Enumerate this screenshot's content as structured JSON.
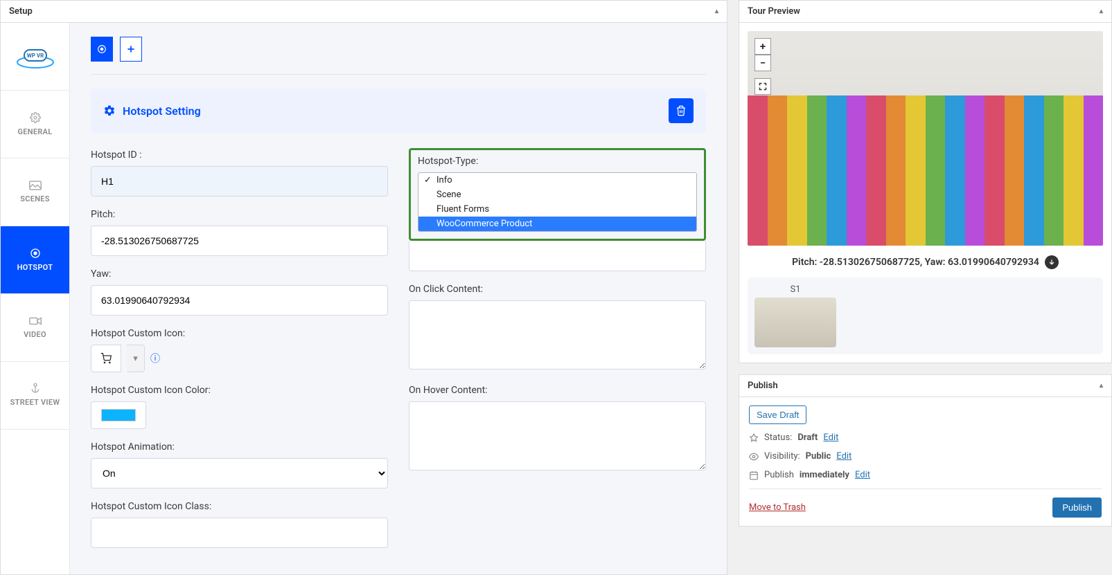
{
  "panels": {
    "setup_title": "Setup",
    "preview_title": "Tour Preview",
    "publish_title": "Publish"
  },
  "sidebar": {
    "items": [
      {
        "label": "GENERAL"
      },
      {
        "label": "SCENES"
      },
      {
        "label": "HOTSPOT"
      },
      {
        "label": "VIDEO"
      },
      {
        "label": "STREET VIEW"
      }
    ]
  },
  "section": {
    "title": "Hotspot Setting"
  },
  "left_fields": {
    "hotspot_id_label": "Hotspot ID :",
    "hotspot_id_value": "H1",
    "pitch_label": "Pitch:",
    "pitch_value": "-28.513026750687725",
    "yaw_label": "Yaw:",
    "yaw_value": "63.01990640792934",
    "custom_icon_label": "Hotspot Custom Icon:",
    "icon_color_label": "Hotspot Custom Icon Color:",
    "animation_label": "Hotspot Animation:",
    "animation_value": "On",
    "icon_class_label": "Hotspot Custom Icon Class:"
  },
  "right_fields": {
    "type_label": "Hotspot-Type:",
    "type_options": [
      "Info",
      "Scene",
      "Fluent Forms",
      "WooCommerce Product"
    ],
    "type_checked": "Info",
    "type_selected": "WooCommerce Product",
    "on_click_label": "On Click Content:",
    "on_hover_label": "On Hover Content:"
  },
  "preview": {
    "meta": "Pitch: -28.513026750687725, Yaw: 63.01990640792934",
    "scene_label": "S1"
  },
  "publish": {
    "save_draft": "Save Draft",
    "status_label": "Status:",
    "status_value": "Draft",
    "visibility_label": "Visibility:",
    "visibility_value": "Public",
    "schedule_label": "Publish",
    "schedule_value": "immediately",
    "edit": "Edit",
    "trash": "Move to Trash",
    "publish_btn": "Publish"
  },
  "colors": {
    "accent": "#004eff",
    "swatch": "#0db3ff",
    "highlight": "#3f8e2f"
  }
}
